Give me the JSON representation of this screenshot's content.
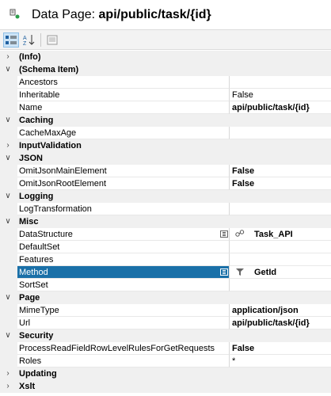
{
  "title": {
    "prefix": "Data Page:",
    "name": "api/public/task/{id}"
  },
  "toolbar": {
    "buttons": [
      "categorized-view",
      "alphabetical-sort",
      "property-pages"
    ]
  },
  "grid": {
    "rows": [
      {
        "kind": "cat",
        "label": "(Info)",
        "expanded": false
      },
      {
        "kind": "cat",
        "label": "(Schema Item)",
        "expanded": true
      },
      {
        "kind": "prop",
        "name": "Ancestors",
        "value": ""
      },
      {
        "kind": "prop",
        "name": "Inheritable",
        "value": "False"
      },
      {
        "kind": "prop",
        "name": "Name",
        "value": "api/public/task/{id}",
        "bold": true
      },
      {
        "kind": "cat",
        "label": "Caching",
        "expanded": true
      },
      {
        "kind": "prop",
        "name": "CacheMaxAge",
        "value": ""
      },
      {
        "kind": "cat",
        "label": "InputValidation",
        "expanded": false
      },
      {
        "kind": "cat",
        "label": "JSON",
        "expanded": true
      },
      {
        "kind": "prop",
        "name": "OmitJsonMainElement",
        "value": "False",
        "bold": true
      },
      {
        "kind": "prop",
        "name": "OmitJsonRootElement",
        "value": "False",
        "bold": true
      },
      {
        "kind": "cat",
        "label": "Logging",
        "expanded": true
      },
      {
        "kind": "prop",
        "name": "LogTransformation",
        "value": ""
      },
      {
        "kind": "cat",
        "label": "Misc",
        "expanded": true
      },
      {
        "kind": "prop",
        "name": "DataStructure",
        "value": "Task_API",
        "bold": true,
        "edit": true,
        "icon": "structure-icon"
      },
      {
        "kind": "prop",
        "name": "DefaultSet",
        "value": ""
      },
      {
        "kind": "prop",
        "name": "Features",
        "value": ""
      },
      {
        "kind": "prop",
        "name": "Method",
        "value": "GetId",
        "bold": true,
        "edit": true,
        "icon": "method-icon",
        "selected": true
      },
      {
        "kind": "prop",
        "name": "SortSet",
        "value": ""
      },
      {
        "kind": "cat",
        "label": "Page",
        "expanded": true
      },
      {
        "kind": "prop",
        "name": "MimeType",
        "value": "application/json",
        "bold": true
      },
      {
        "kind": "prop",
        "name": "Url",
        "value": "api/public/task/{id}",
        "bold": true
      },
      {
        "kind": "cat",
        "label": "Security",
        "expanded": true
      },
      {
        "kind": "prop",
        "name": "ProcessReadFieldRowLevelRulesForGetRequests",
        "value": "False",
        "bold": true
      },
      {
        "kind": "prop",
        "name": "Roles",
        "value": "*"
      },
      {
        "kind": "cat",
        "label": "Updating",
        "expanded": false
      },
      {
        "kind": "cat",
        "label": "Xslt",
        "expanded": false
      }
    ]
  }
}
